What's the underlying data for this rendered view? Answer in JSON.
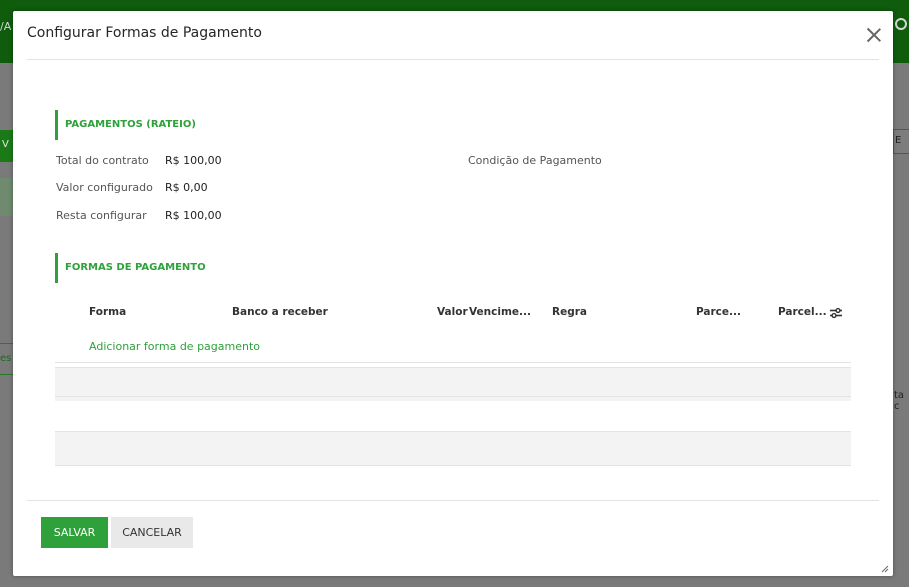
{
  "background": {
    "topbar_fragment": "/A",
    "green_button_fragment": "V",
    "left_outline_fragment": "es",
    "right_button_fragment": "E",
    "right_text_fragment": "ta c"
  },
  "modal": {
    "title": "Configurar Formas de Pagamento",
    "payments_section": {
      "title": "PAGAMENTOS (RATEIO)",
      "total_label": "Total do contrato",
      "total_value": "R$ 100,00",
      "configured_label": "Valor configurado",
      "configured_value": "R$ 0,00",
      "remaining_label": "Resta configurar",
      "remaining_value": "R$ 100,00",
      "condition_label": "Condição de Pagamento"
    },
    "forms_section": {
      "title": "FORMAS DE PAGAMENTO",
      "columns": [
        "Forma",
        "Banco a receber",
        "Valor",
        "Vencime...",
        "Regra",
        "Parce...",
        "Parcel..."
      ],
      "add_link": "Adicionar forma de pagamento"
    },
    "buttons": {
      "save": "SALVAR",
      "cancel": "CANCELAR"
    }
  },
  "colors": {
    "accent": "#2ea13a",
    "topbar": "#0f5c0d"
  },
  "icons": {
    "close": "close-icon",
    "column_settings": "sliders-icon",
    "resize": "resize-grip-icon"
  }
}
